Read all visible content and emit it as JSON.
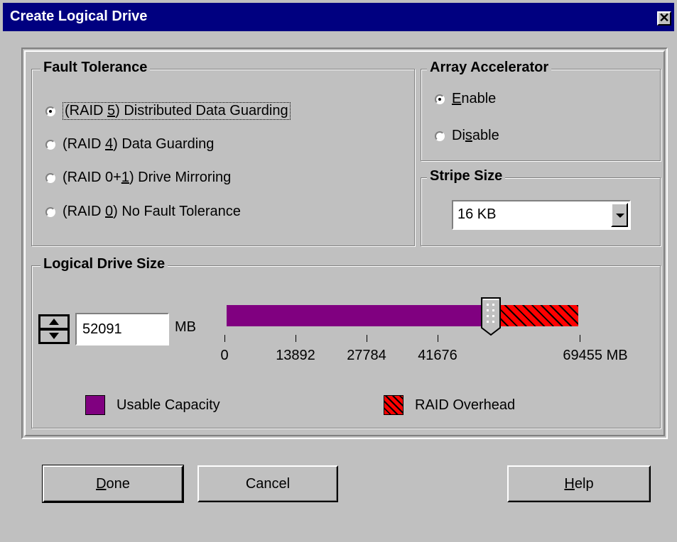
{
  "window": {
    "title": "Create Logical Drive",
    "close_glyph": "✕"
  },
  "fault_tolerance": {
    "label": "Fault Tolerance",
    "options": [
      {
        "pre": "(RAID ",
        "mn": "5",
        "post": ") Distributed Data Guarding",
        "selected": true
      },
      {
        "pre": "(RAID ",
        "mn": "4",
        "post": ") Data Guarding",
        "selected": false
      },
      {
        "pre": "(RAID 0+",
        "mn": "1",
        "post": ") Drive Mirroring",
        "selected": false
      },
      {
        "pre": "(RAID ",
        "mn": "0",
        "post": ") No Fault Tolerance",
        "selected": false
      }
    ]
  },
  "array_accelerator": {
    "label": "Array Accelerator",
    "enable": {
      "pre": "",
      "mn": "E",
      "post": "nable",
      "selected": true
    },
    "disable": {
      "pre": "Di",
      "mn": "s",
      "post": "able",
      "selected": false
    }
  },
  "stripe_size": {
    "label": "Stripe Size",
    "value": "16 KB"
  },
  "logical_drive_size": {
    "label": "Logical Drive Size",
    "value": "52091",
    "unit": "MB",
    "max_mb": 69455,
    "ticks": [
      "0",
      "13892",
      "27784",
      "41676",
      "69455 MB"
    ],
    "legend": {
      "usable": "Usable Capacity",
      "overhead": "RAID Overhead"
    }
  },
  "colors": {
    "usable": "#800080",
    "overhead": "#ff0000",
    "titlebar": "#000080"
  },
  "buttons": {
    "done": {
      "pre": "",
      "mn": "D",
      "post": "one"
    },
    "cancel": "Cancel",
    "help": {
      "pre": "",
      "mn": "H",
      "post": "elp"
    }
  },
  "icons": {
    "spinner": "spin-up-down-icon",
    "combo": "chevron-down-icon",
    "slider": "slider-thumb-icon",
    "close": "close-icon"
  }
}
